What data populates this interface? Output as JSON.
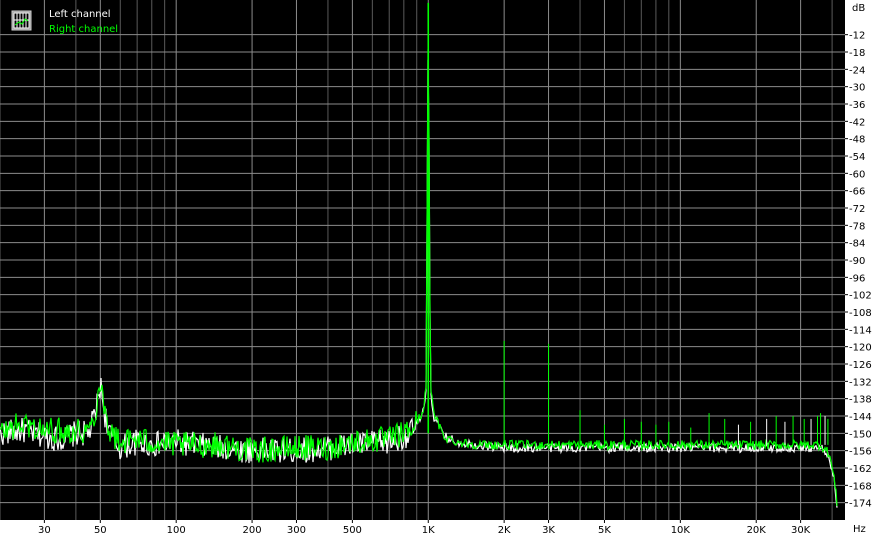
{
  "legend": {
    "left_label": "Left channel",
    "right_label": "Right channel",
    "icon": "grid-toggle-icon"
  },
  "chart_data": {
    "type": "line",
    "title": "",
    "xlabel": "Hz",
    "ylabel": "dB",
    "x_scale": "log",
    "xlim": [
      20,
      45000
    ],
    "ylim": [
      -180,
      0
    ],
    "grid": true,
    "legend_position": "top-left",
    "background": "#000000",
    "x_ticks": [
      {
        "value": 30,
        "label": "30"
      },
      {
        "value": 50,
        "label": "50"
      },
      {
        "value": 100,
        "label": "100"
      },
      {
        "value": 200,
        "label": "200"
      },
      {
        "value": 300,
        "label": "300"
      },
      {
        "value": 500,
        "label": "500"
      },
      {
        "value": 1000,
        "label": "1K"
      },
      {
        "value": 2000,
        "label": "2K"
      },
      {
        "value": 3000,
        "label": "3K"
      },
      {
        "value": 5000,
        "label": "5K"
      },
      {
        "value": 10000,
        "label": "10K"
      },
      {
        "value": 20000,
        "label": "20K"
      },
      {
        "value": 30000,
        "label": "30K"
      }
    ],
    "y_ticks": [
      -12,
      -18,
      -24,
      -30,
      -36,
      -42,
      -48,
      -54,
      -60,
      -66,
      -72,
      -78,
      -84,
      -90,
      -96,
      -102,
      -108,
      -114,
      -120,
      -126,
      -132,
      -138,
      -144,
      -150,
      -156,
      -162,
      -168,
      -174
    ],
    "series": [
      {
        "name": "Left channel",
        "color": "#ffffff",
        "points": [
          [
            20,
            -150
          ],
          [
            25,
            -149
          ],
          [
            30,
            -151
          ],
          [
            35,
            -152
          ],
          [
            40,
            -150
          ],
          [
            45,
            -150
          ],
          [
            48,
            -143
          ],
          [
            50,
            -133
          ],
          [
            52,
            -143
          ],
          [
            55,
            -151
          ],
          [
            60,
            -155
          ],
          [
            70,
            -153
          ],
          [
            80,
            -154
          ],
          [
            100,
            -153
          ],
          [
            150,
            -155
          ],
          [
            200,
            -156
          ],
          [
            300,
            -156
          ],
          [
            400,
            -155
          ],
          [
            500,
            -154
          ],
          [
            700,
            -153
          ],
          [
            850,
            -150
          ],
          [
            950,
            -144
          ],
          [
            980,
            -135
          ],
          [
            1000,
            -5
          ],
          [
            1020,
            -135
          ],
          [
            1050,
            -144
          ],
          [
            1150,
            -151
          ],
          [
            1300,
            -153
          ],
          [
            1600,
            -154
          ],
          [
            2000,
            -155
          ],
          [
            3000,
            -155
          ],
          [
            5000,
            -155
          ],
          [
            10000,
            -155
          ],
          [
            15000,
            -155
          ],
          [
            20000,
            -155
          ],
          [
            30000,
            -155
          ],
          [
            36000,
            -155
          ],
          [
            39000,
            -158
          ],
          [
            41000,
            -168
          ],
          [
            42000,
            -176
          ]
        ]
      },
      {
        "name": "Right channel",
        "color": "#00ff00",
        "points": [
          [
            20,
            -150
          ],
          [
            22,
            -148
          ],
          [
            25,
            -147
          ],
          [
            30,
            -149
          ],
          [
            35,
            -149
          ],
          [
            40,
            -149
          ],
          [
            45,
            -149
          ],
          [
            48,
            -142
          ],
          [
            50,
            -131
          ],
          [
            52,
            -142
          ],
          [
            55,
            -150
          ],
          [
            60,
            -153
          ],
          [
            70,
            -152
          ],
          [
            80,
            -153
          ],
          [
            100,
            -154
          ],
          [
            150,
            -154
          ],
          [
            200,
            -156
          ],
          [
            300,
            -155
          ],
          [
            400,
            -155
          ],
          [
            500,
            -153
          ],
          [
            700,
            -152
          ],
          [
            850,
            -149
          ],
          [
            950,
            -143
          ],
          [
            980,
            -134
          ],
          [
            1000,
            -1
          ],
          [
            1020,
            -134
          ],
          [
            1050,
            -143
          ],
          [
            1150,
            -151
          ],
          [
            1300,
            -153
          ],
          [
            1600,
            -154
          ],
          [
            2000,
            -154
          ],
          [
            3000,
            -154
          ],
          [
            5000,
            -154
          ],
          [
            10000,
            -154
          ],
          [
            15000,
            -154
          ],
          [
            20000,
            -154
          ],
          [
            30000,
            -154
          ],
          [
            36000,
            -154
          ],
          [
            39000,
            -157
          ],
          [
            41000,
            -167
          ],
          [
            42000,
            -176
          ]
        ]
      }
    ],
    "spurs": [
      {
        "freq": 2000,
        "db": -118,
        "channel": "Right channel"
      },
      {
        "freq": 3000,
        "db": -119,
        "channel": "Right channel"
      },
      {
        "freq": 4000,
        "db": -142,
        "channel": "Right channel"
      },
      {
        "freq": 5000,
        "db": -147,
        "channel": "Right channel"
      },
      {
        "freq": 6000,
        "db": -145,
        "channel": "Right channel"
      },
      {
        "freq": 7000,
        "db": -146,
        "channel": "Right channel"
      },
      {
        "freq": 8000,
        "db": -147,
        "channel": "Right channel"
      },
      {
        "freq": 9000,
        "db": -146,
        "channel": "Right channel"
      },
      {
        "freq": 11000,
        "db": -148,
        "channel": "Right channel"
      },
      {
        "freq": 13000,
        "db": -143,
        "channel": "Right channel"
      },
      {
        "freq": 15000,
        "db": -145,
        "channel": "Right channel"
      },
      {
        "freq": 17000,
        "db": -147,
        "channel": "Left channel"
      },
      {
        "freq": 19000,
        "db": -146,
        "channel": "Right channel"
      },
      {
        "freq": 22000,
        "db": -145,
        "channel": "Left channel"
      },
      {
        "freq": 24000,
        "db": -144,
        "channel": "Right channel"
      },
      {
        "freq": 26000,
        "db": -146,
        "channel": "Left channel"
      },
      {
        "freq": 28000,
        "db": -144,
        "channel": "Right channel"
      },
      {
        "freq": 31000,
        "db": -145,
        "channel": "Right channel"
      },
      {
        "freq": 33000,
        "db": -145,
        "channel": "Left channel"
      },
      {
        "freq": 35000,
        "db": -144,
        "channel": "Right channel"
      },
      {
        "freq": 36000,
        "db": -143,
        "channel": "Right channel"
      },
      {
        "freq": 37500,
        "db": -144,
        "channel": "Left channel"
      },
      {
        "freq": 38500,
        "db": -145,
        "channel": "Right channel"
      }
    ]
  }
}
